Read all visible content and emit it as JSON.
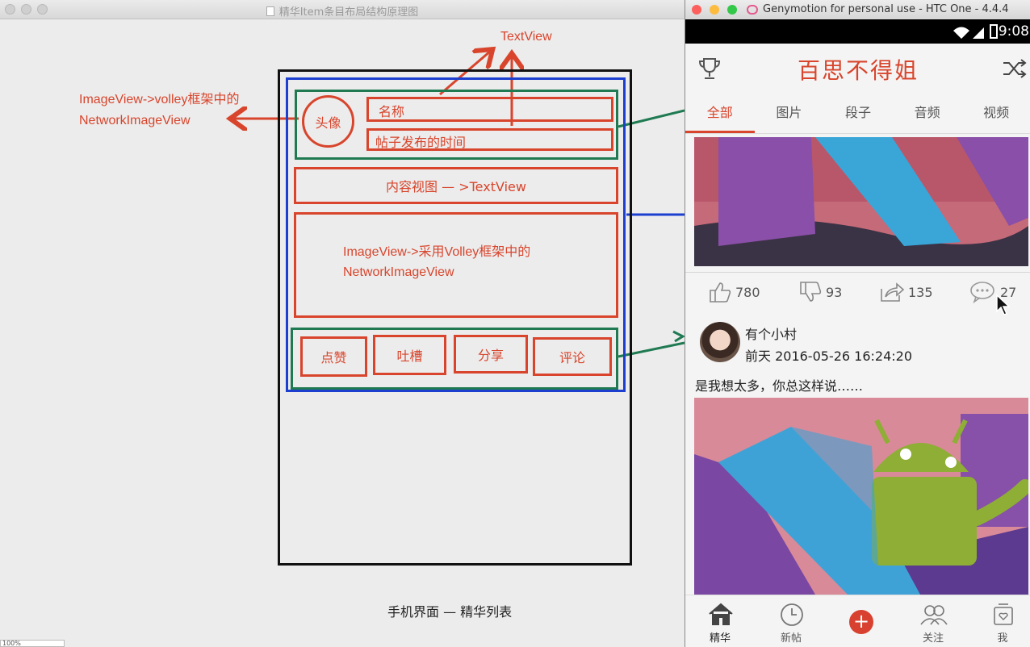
{
  "left_window": {
    "title": "精华Item条目布局结构原理图",
    "zoom": "100%"
  },
  "diagram": {
    "textview_top": "TextView",
    "imageview_note_line1": "ImageView->volley框架中的",
    "imageview_note_line2": "NetworkImageView",
    "avatar_label": "头像",
    "name_label": "名称",
    "time_label": "帖子发布的时间",
    "content_label": "内容视图 — >TextView",
    "image_label_line1": "ImageView->采用Volley框架中的",
    "image_label_line2": "NetworkImageView",
    "buttons": [
      "点赞",
      "吐槽",
      "分享",
      "评论"
    ],
    "caption": "手机界面 — 精华列表",
    "colors": {
      "red": "#d8452c",
      "green": "#1f7a52",
      "blue": "#1c3fd0"
    }
  },
  "emulator": {
    "title": "Genymotion for personal use - HTC One - 4.4.4",
    "time": "9:08",
    "app_title": "百思不得姐",
    "tabs": [
      "全部",
      "图片",
      "段子",
      "音频",
      "视频"
    ],
    "actions": {
      "like": "780",
      "dislike": "93",
      "share": "135",
      "comment": "27"
    },
    "post": {
      "user": "有个小村",
      "time": "前天 2016-05-26 16:24:20",
      "text": "是我想太多，你总这样说……"
    },
    "nav": [
      "精华",
      "新帖",
      "关注",
      "我"
    ],
    "accent": "#d8452c"
  }
}
